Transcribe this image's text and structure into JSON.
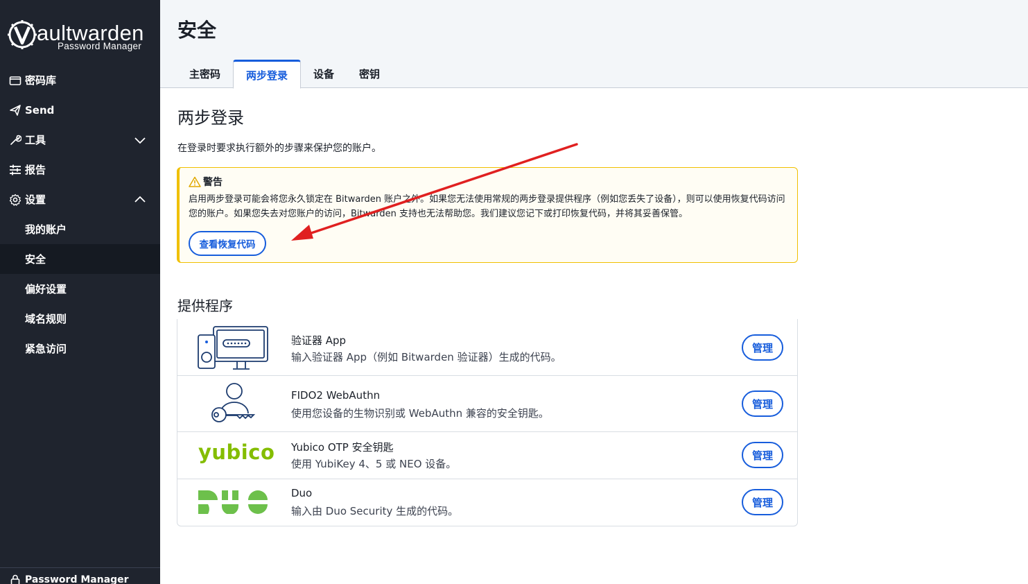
{
  "app": {
    "logo_word": "aultwarden",
    "logo_sub": "Password Manager"
  },
  "sidebar": {
    "items": [
      {
        "label": "密码库",
        "icon": "vault-icon"
      },
      {
        "label": "Send",
        "icon": "send-icon"
      },
      {
        "label": "工具",
        "icon": "wrench-icon",
        "chevron": "down"
      },
      {
        "label": "报告",
        "icon": "sliders-icon"
      },
      {
        "label": "设置",
        "icon": "gear-icon",
        "chevron": "up"
      }
    ],
    "sub_items": [
      {
        "label": "我的账户"
      },
      {
        "label": "安全",
        "active": true
      },
      {
        "label": "偏好设置"
      },
      {
        "label": "域名规则"
      },
      {
        "label": "紧急访问"
      }
    ],
    "footer_label": "Password Manager"
  },
  "header": {
    "title": "安全",
    "tabs": [
      {
        "label": "主密码"
      },
      {
        "label": "两步登录",
        "active": true
      },
      {
        "label": "设备"
      },
      {
        "label": "密钥"
      }
    ]
  },
  "main": {
    "section_title": "两步登录",
    "section_desc": "在登录时要求执行额外的步骤来保护您的账户。",
    "warning": {
      "title": "警告",
      "text": "启用两步登录可能会将您永久锁定在 Bitwarden 账户之外。如果您无法使用常规的两步登录提供程序（例如您丢失了设备），则可以使用恢复代码访问您的账户。如果您失去对您账户的访问，Bitwarden 支持也无法帮助您。我们建议您记下或打印恢复代码，并将其妥善保管。",
      "button_label": "查看恢复代码"
    },
    "providers_title": "提供程序",
    "providers": [
      {
        "name": "验证器 App",
        "desc": "输入验证器 App（例如 Bitwarden 验证器）生成的代码。",
        "button": "管理",
        "icon": "authenticator-app-icon"
      },
      {
        "name": "FIDO2 WebAuthn",
        "desc": "使用您设备的生物识别或 WebAuthn 兼容的安全钥匙。",
        "button": "管理",
        "icon": "webauthn-key-icon"
      },
      {
        "name": "Yubico OTP 安全钥匙",
        "desc": "使用 YubiKey 4、5 或 NEO 设备。",
        "button": "管理",
        "logo_text": "yubico"
      },
      {
        "name": "Duo",
        "desc": "输入由 Duo Security 生成的代码。",
        "button": "管理",
        "logo_text": "DUO"
      }
    ]
  },
  "colors": {
    "sidebar_bg": "#1f242e",
    "primary": "#175ddc",
    "warning": "#f0c000",
    "yubico_green": "#84bd00",
    "duo_green": "#6dc04b",
    "annotation_red": "#e02020"
  }
}
